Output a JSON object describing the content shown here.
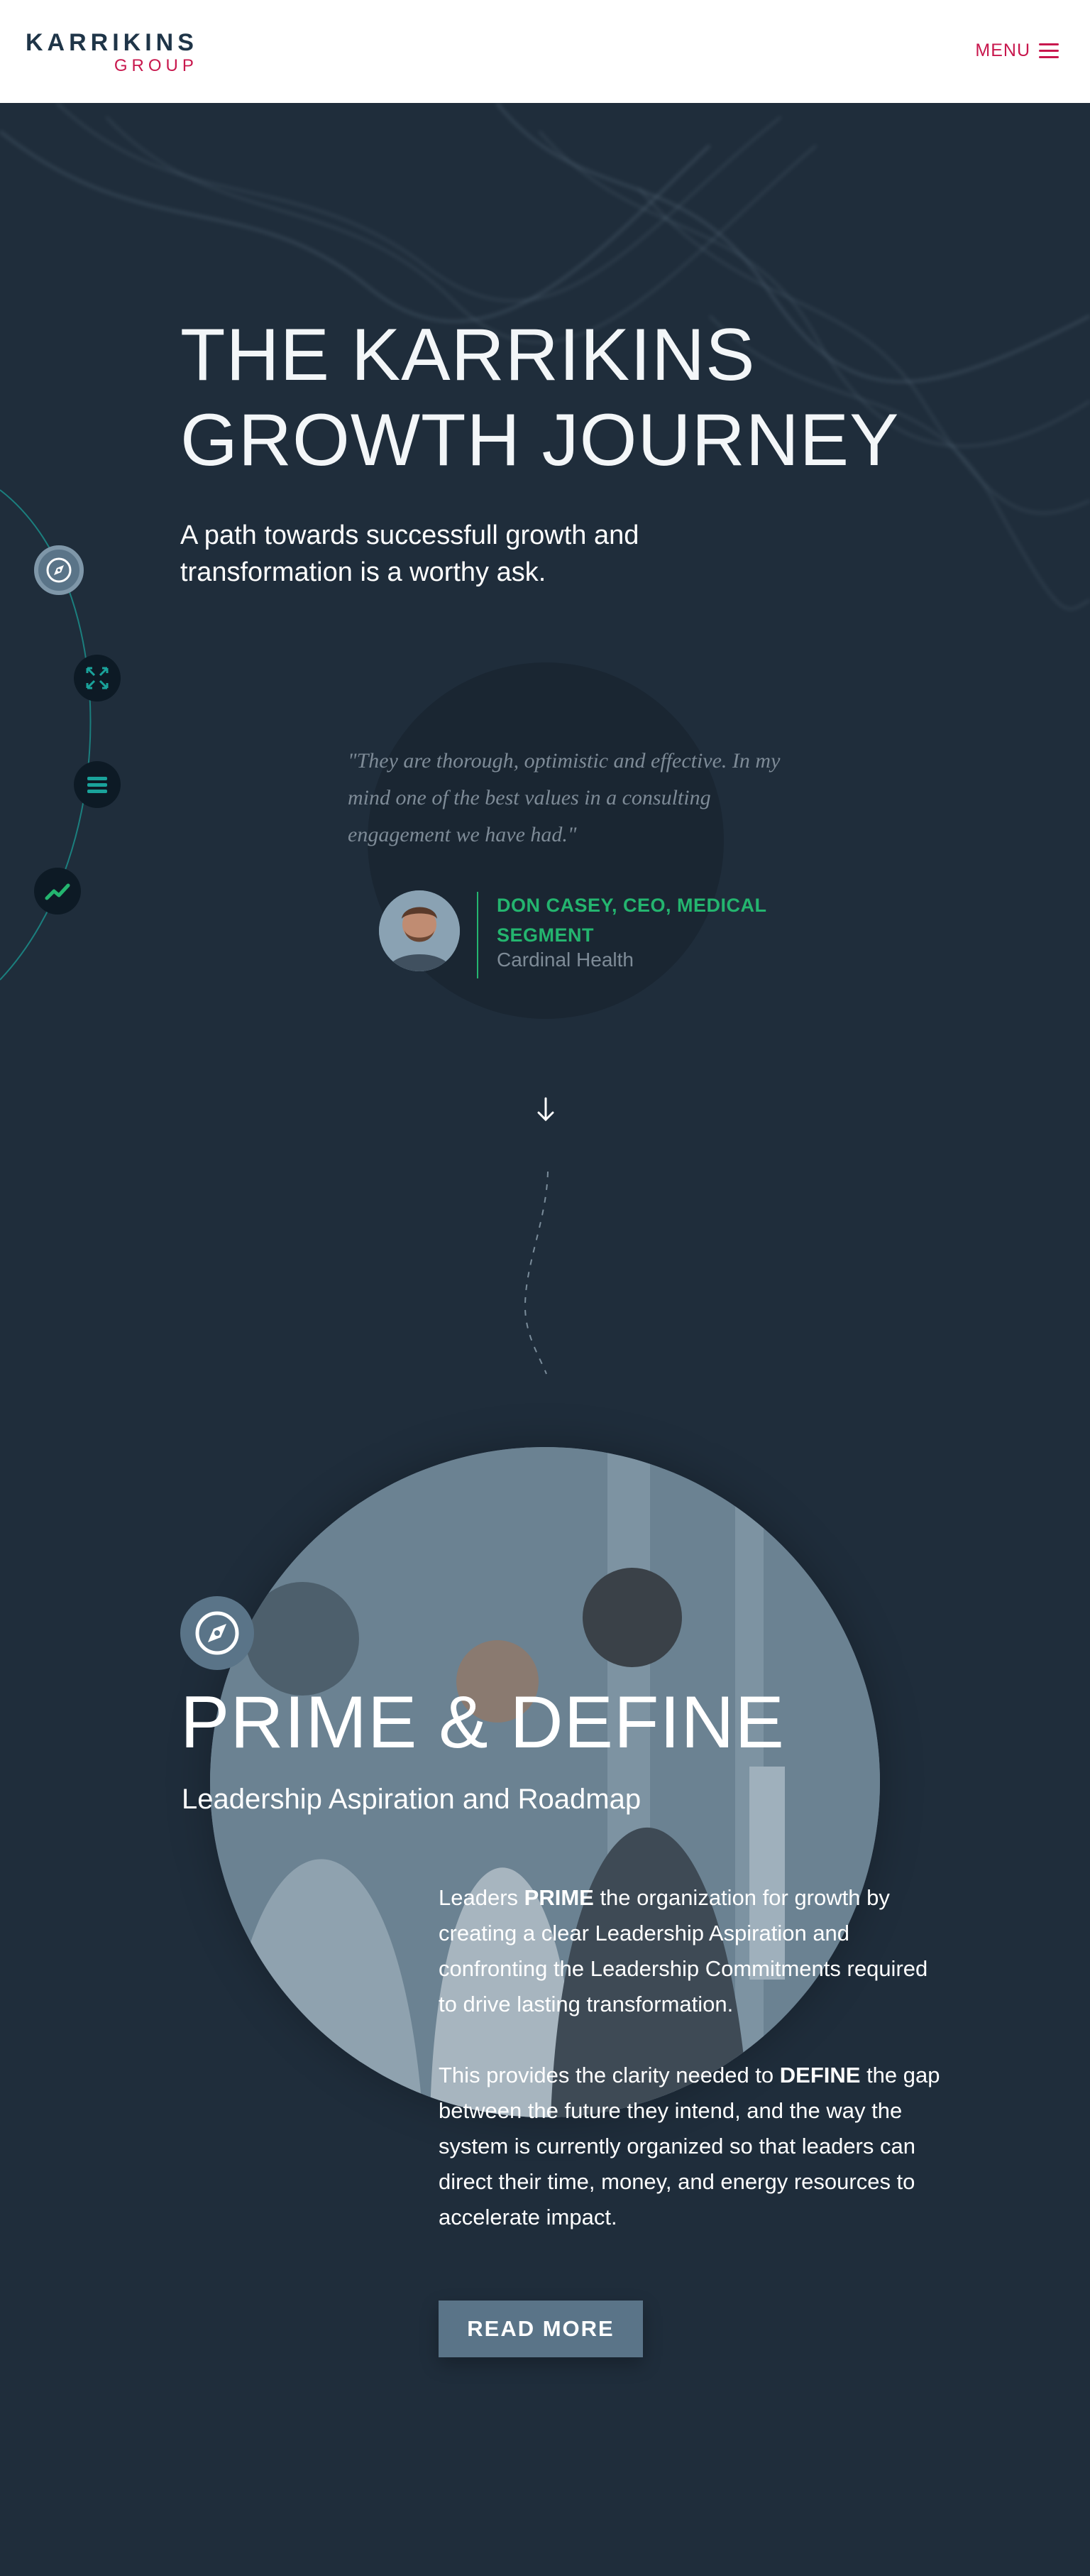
{
  "header": {
    "logo_main": "KARRIKINS",
    "logo_sub": "GROUP",
    "menu_label": "MENU"
  },
  "hero": {
    "title_line1": "THE KARRIKINS",
    "title_line2": "GROWTH JOURNEY",
    "subtitle": "A path towards successfull growth and transformation is a worthy ask."
  },
  "side_nav": {
    "items": [
      {
        "icon": "compass-icon",
        "active": true
      },
      {
        "icon": "expand-arrows-icon",
        "active": false
      },
      {
        "icon": "list-icon",
        "active": false
      },
      {
        "icon": "trend-up-icon",
        "active": false
      }
    ]
  },
  "testimonial": {
    "quote": "\"They are thorough, optimistic and effective. In my mind one of the best values in a consulting engagement we have had.\"",
    "name": "DON CASEY, CEO, MEDICAL SEGMENT",
    "company": "Cardinal Health"
  },
  "section": {
    "icon": "compass-icon",
    "title": "PRIME & DEFINE",
    "subtitle": "Leadership Aspiration and Roadmap",
    "p1_pre": "Leaders ",
    "p1_bold": "PRIME",
    "p1_post": " the organization for growth by creating a clear Leadership Aspiration and confronting the Leadership Commitments required to drive lasting transformation.",
    "p2_pre": "This provides the clarity needed to ",
    "p2_bold": "DEFINE",
    "p2_post": " the gap between the future they intend, and the way the system is currently organized so that leaders can direct their time, money, and energy resources to accelerate impact.",
    "button_label": "READ MORE"
  },
  "colors": {
    "background": "#1f2d3b",
    "accent_red": "#c8174d",
    "accent_green": "#24b56f",
    "slate": "#5a7488"
  }
}
